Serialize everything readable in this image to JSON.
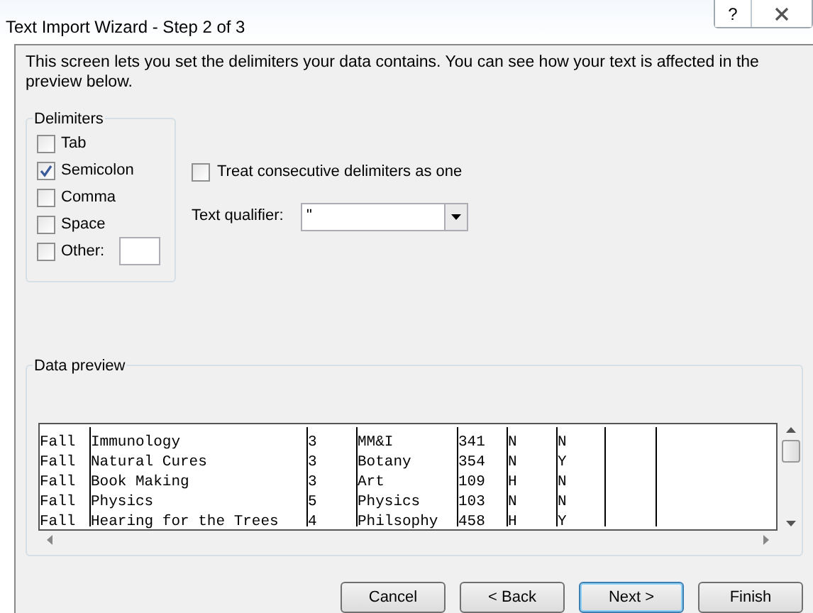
{
  "window": {
    "title": "Text Import Wizard - Step 2 of 3",
    "help": "?"
  },
  "description": "This screen lets you set the delimiters your data contains.  You can see how your text is affected in the preview below.",
  "delimiters": {
    "title": "Delimiters",
    "items": [
      {
        "label": "Tab",
        "checked": false
      },
      {
        "label": "Semicolon",
        "checked": true
      },
      {
        "label": "Comma",
        "checked": false
      },
      {
        "label": "Space",
        "checked": false
      },
      {
        "label": "Other:",
        "checked": false,
        "kind": "other"
      }
    ]
  },
  "consecutive": {
    "label": "Treat consecutive delimiters as one",
    "checked": false
  },
  "qualifier": {
    "label": "Text qualifier:",
    "value": "\""
  },
  "preview": {
    "title": "Data preview",
    "rows": [
      [
        "Fall",
        "Immunology",
        "3",
        "MM&I",
        "341",
        "N",
        "N"
      ],
      [
        "Fall",
        "Natural Cures",
        "3",
        "Botany",
        "354",
        "N",
        "Y"
      ],
      [
        "Fall",
        "Book Making",
        "3",
        "Art",
        "109",
        "H",
        "N"
      ],
      [
        "Fall",
        "Physics",
        "5",
        "Physics",
        "103",
        "N",
        "N"
      ],
      [
        "Fall",
        "Hearing for the Trees",
        "4",
        "Philsophy",
        "458",
        "H",
        "Y"
      ]
    ]
  },
  "buttons": [
    {
      "label": "Cancel",
      "default": false
    },
    {
      "label": "< Back",
      "default": false
    },
    {
      "label": "Next >",
      "default": true
    },
    {
      "label": "Finish",
      "default": false
    }
  ]
}
